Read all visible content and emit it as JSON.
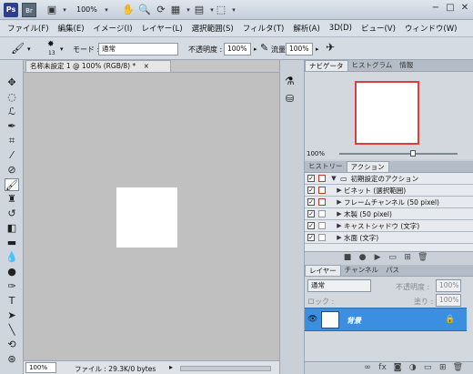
{
  "appbar": {
    "ps": "Ps",
    "br": "Br",
    "zoom": "100%"
  },
  "menu": [
    "ファイル(F)",
    "編集(E)",
    "イメージ(I)",
    "レイヤー(L)",
    "選択範囲(S)",
    "フィルタ(T)",
    "解析(A)",
    "3D(D)",
    "ビュー(V)",
    "ウィンドウ(W)"
  ],
  "options": {
    "brush_size": "13",
    "mode_label": "モード :",
    "mode_value": "通常",
    "opacity_label": "不透明度 :",
    "opacity_value": "100%",
    "flow_label": "流量 :",
    "flow_value": "100%"
  },
  "document": {
    "tab_title": "名称未設定 1 @ 100% (RGB/8) *",
    "tab_close": "×",
    "zoom": "100%",
    "file_info": "ファイル : 29.3K/0 bytes"
  },
  "navigator": {
    "tabs": [
      "ナビゲータ",
      "ヒストグラム",
      "情報"
    ],
    "zoom": "100%"
  },
  "actions": {
    "tabs": [
      "ヒストリー",
      "アクション"
    ],
    "set_name": "初期設定のアクション",
    "items": [
      "ビネット (選択範囲)",
      "フレームチャンネル (50 pixel)",
      "木製 (50 pixel)",
      "キャストシャドウ (文字)",
      "水面 (文字)"
    ]
  },
  "layers": {
    "tabs": [
      "レイヤー",
      "チャンネル",
      "パス"
    ],
    "blend_mode": "通常",
    "opacity_label": "不透明度 :",
    "opacity_value": "100%",
    "lock_label": "ロック :",
    "fill_label": "塗り :",
    "fill_value": "100%",
    "layer_name": "背景"
  },
  "colors": {
    "selection": "#3b8fe0",
    "navigator_frame": "#d9413e"
  }
}
